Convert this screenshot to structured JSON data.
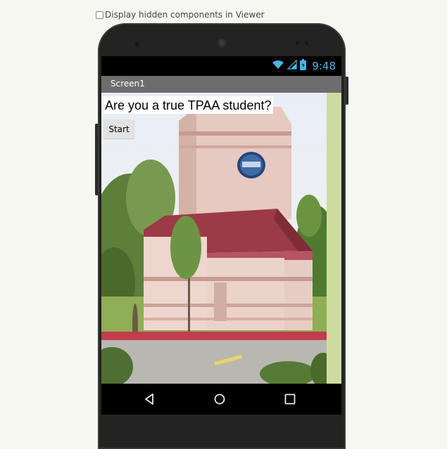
{
  "viewer": {
    "hidden_components_label": "Display hidden components in Viewer",
    "hidden_components_checked": false
  },
  "status_bar": {
    "time": "9:48",
    "icons": [
      "wifi-icon",
      "cell-signal-icon",
      "battery-icon"
    ],
    "accent_color": "#4ab3e6"
  },
  "screen": {
    "title": "Screen1"
  },
  "components": {
    "label_text": "Are you a true TPAA student?",
    "start_button_label": "Start"
  },
  "nav_bar": {
    "icons": [
      "back-icon",
      "home-icon",
      "recents-icon"
    ]
  },
  "colors": {
    "title_bar": "#6d6d6d",
    "screen_background": "#cddc9e",
    "phone_body": "#232323",
    "page_background": "#f7f7f2"
  }
}
